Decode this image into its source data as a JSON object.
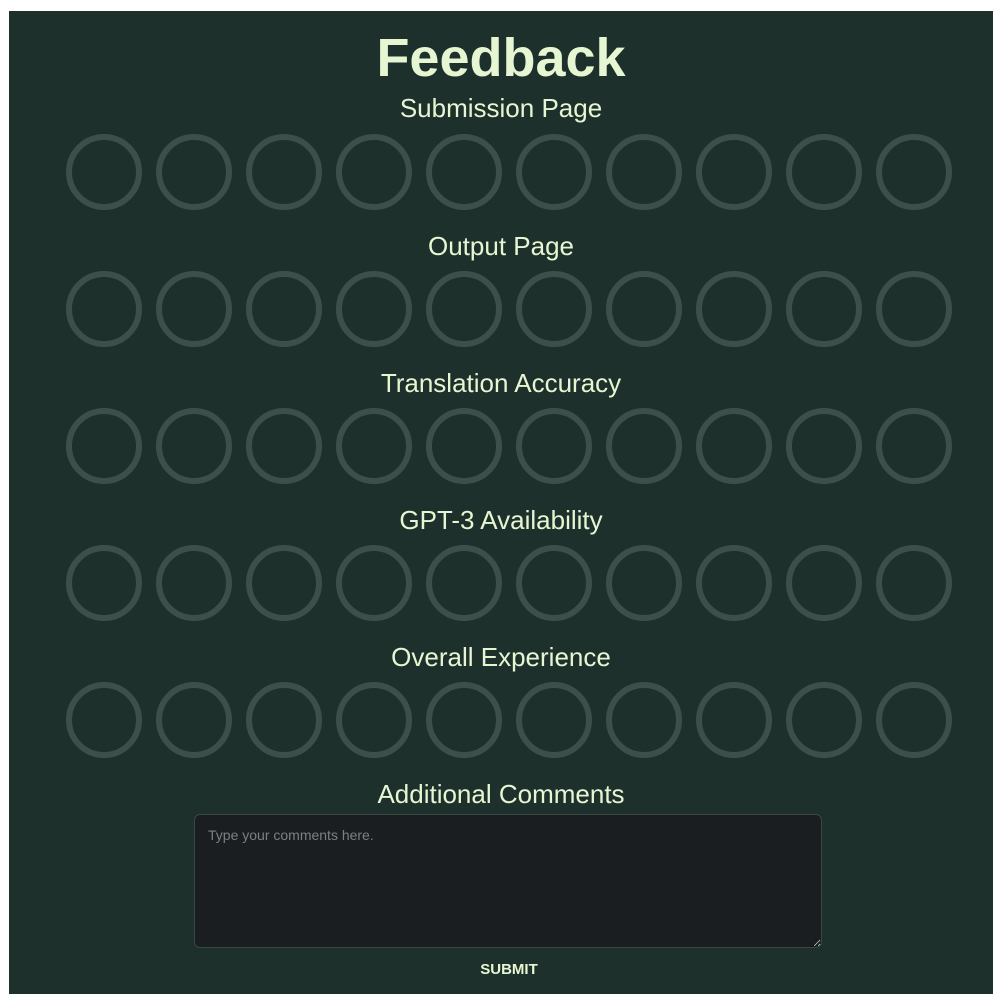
{
  "page": {
    "title": "Feedback"
  },
  "sections": [
    {
      "label": "Submission Page",
      "rating_count": 10,
      "selected": null
    },
    {
      "label": "Output Page",
      "rating_count": 10,
      "selected": null
    },
    {
      "label": "Translation Accuracy",
      "rating_count": 10,
      "selected": null
    },
    {
      "label": "GPT-3 Availability",
      "rating_count": 10,
      "selected": null
    },
    {
      "label": "Overall Experience",
      "rating_count": 10,
      "selected": null
    }
  ],
  "comments": {
    "label": "Additional Comments",
    "value": "",
    "placeholder": "Type your comments here."
  },
  "submit": {
    "label": "SUBMIT"
  },
  "colors": {
    "background": "#1e302c",
    "text": "#e7f6d2",
    "circle_border": "#3e4f4b",
    "textarea_bg": "#1a1e21"
  }
}
